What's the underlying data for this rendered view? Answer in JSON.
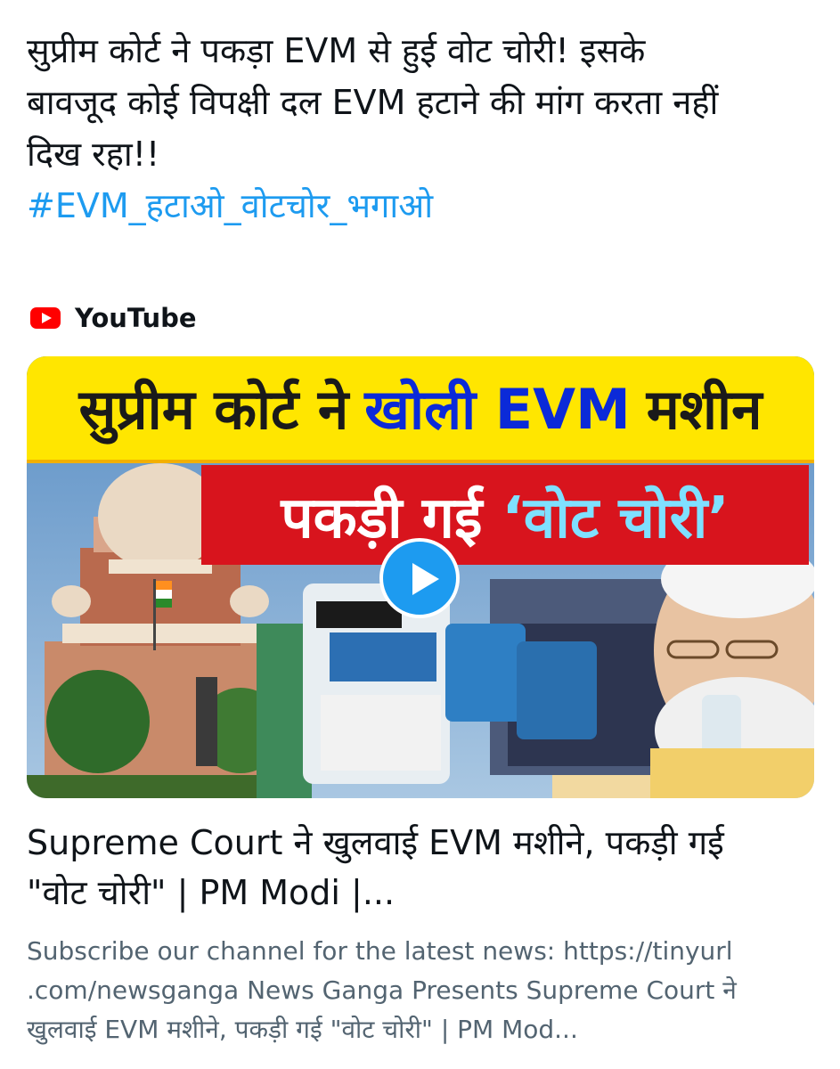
{
  "post": {
    "text_lines": [
      "सुप्रीम कोर्ट ने पकड़ा EVM से हुई वोट चोरी! इसके",
      "बावजूद कोई विपक्षी दल EVM हटाने की मांग करता नहीं",
      "दिख रहा!!"
    ],
    "hashtag": "#EVM_हटाओ_वोटचोर_भगाओ"
  },
  "card": {
    "source": "YouTube",
    "source_icon": "youtube-logo-icon",
    "thumbnail": {
      "banner_top": [
        "सुप्रीम कोर्ट ने",
        "खोली EVM",
        "मशीन"
      ],
      "banner_bottom": [
        "पकड़ी गई",
        "‘वोट चोरी’"
      ],
      "play_icon": "play-icon",
      "colors": {
        "yellow": "#ffe600",
        "red": "#d8141d",
        "blue_text": "#0b2ad8",
        "cyan_text": "#7fe0ff"
      }
    },
    "title_lines": [
      "Supreme Court ने खुलवाई EVM मशीने, पकड़ी गई",
      "\"वोट चोरी\" | PM Modi |..."
    ],
    "description_lines": [
      "Subscribe our channel for the latest news: https://tinyurl",
      ".com/newsganga News Ganga Presents Supreme Court ने",
      "खुलवाई EVM मशीने, पकड़ी गई \"वोट चोरी\" | PM Mod..."
    ]
  },
  "colors": {
    "link": "#1d9bf0",
    "text": "#0f1419",
    "secondary": "#536471",
    "youtube_red": "#ff0000"
  }
}
